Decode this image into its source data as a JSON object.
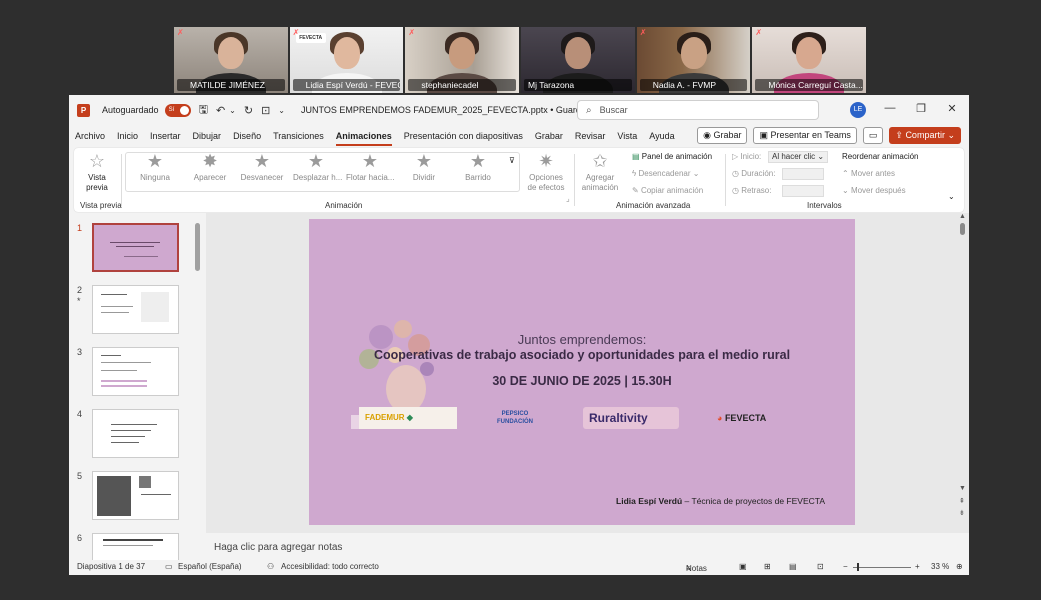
{
  "participants": [
    {
      "name": "MATILDE JIMÉNEZ",
      "muted": true
    },
    {
      "name": "Lidia Espí Verdú - FEVECTA",
      "muted": true,
      "active": true,
      "overlay": "FEVECTA"
    },
    {
      "name": "stephaniecadel",
      "muted": true
    },
    {
      "name": "Mj Tarazona",
      "muted": false
    },
    {
      "name": "Nadia A. - FVMP",
      "muted": true
    },
    {
      "name": "Mónica Carreguí Casta...",
      "muted": true
    }
  ],
  "titlebar": {
    "app_icon": "P",
    "autosave_label": "Autoguardado",
    "autosave_state": "Sí",
    "doc_title": "JUNTOS EMPRENDEMOS FADEMUR_2025_FEVECTA.pptx  •  Guardado ⌄",
    "search_placeholder": "Buscar",
    "avatar_initials": "LE"
  },
  "menu": {
    "tabs": [
      "Archivo",
      "Inicio",
      "Insertar",
      "Dibujar",
      "Diseño",
      "Transiciones",
      "Animaciones",
      "Presentación con diapositivas",
      "Grabar",
      "Revisar",
      "Vista",
      "Ayuda"
    ],
    "active_tab": "Animaciones",
    "record_label": "Grabar",
    "teams_label": "Presentar en Teams",
    "share_label": "Compartir"
  },
  "ribbon": {
    "preview_label": "Vista previa",
    "preview_group": "Vista previa",
    "animations": [
      "Ninguna",
      "Aparecer",
      "Desvanecer",
      "Desplazar h...",
      "Flotar hacia...",
      "Dividir",
      "Barrido"
    ],
    "animation_group": "Animación",
    "effect_options": "Opciones de efectos",
    "add_animation": "Agregar animación",
    "animation_panel": "Panel de animación",
    "trigger": "Desencadenar",
    "copy_animation": "Copiar animación",
    "advanced_group": "Animación avanzada",
    "start_label": "Inicio:",
    "start_value": "Al hacer clic",
    "duration_label": "Duración:",
    "delay_label": "Retraso:",
    "reorder_label": "Reordenar animación",
    "move_earlier": "Mover antes",
    "move_later": "Mover después",
    "timing_group": "Intervalos"
  },
  "thumbnails": [
    {
      "num": "1",
      "active": true
    },
    {
      "num": "2",
      "marker": "*"
    },
    {
      "num": "3"
    },
    {
      "num": "4"
    },
    {
      "num": "5"
    },
    {
      "num": "6"
    }
  ],
  "slide": {
    "subtitle": "Juntos emprendemos:",
    "title": "Cooperativas de trabajo asociado y oportunidades para el medio rural",
    "date": "30 DE JUNIO DE 2025 | 15.30H",
    "presenter": "Lidia Espí Verdú",
    "presenter_role": " – Técnica de proyectos de FEVECTA",
    "logos": [
      "FADEMUR",
      "PEPSICO FUNDACIÓN",
      "Ruraltivity",
      "FEVECTA"
    ]
  },
  "notes_placeholder": "Haga clic para agregar notas",
  "status": {
    "slide_counter": "Diapositiva 1 de 37",
    "language": "Español (España)",
    "accessibility": "Accesibilidad: todo correcto",
    "notes_label": "Notas",
    "zoom": "33 %"
  },
  "colors": {
    "accent": "#c43e1c",
    "slide_bg": "#cfa8cf",
    "active_tile": "#3ad17c"
  }
}
